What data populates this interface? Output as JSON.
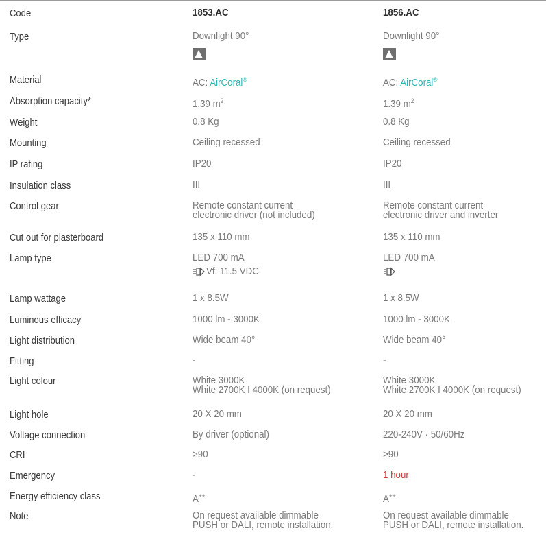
{
  "columns": {
    "label": "Code",
    "product1": "1853.AC",
    "product2": "1856.AC"
  },
  "rows": {
    "type": {
      "label": "Type",
      "v1": "Downlight 90°",
      "v2": "Downlight 90°"
    },
    "material": {
      "label": "Material",
      "prefix1": "AC: ",
      "link1": "AirCoral",
      "reg1": "®",
      "prefix2": "AC: ",
      "link2": "AirCoral",
      "reg2": "®"
    },
    "absorption": {
      "label": "Absorption capacity*",
      "v1": "1.39 m",
      "sup1": "2",
      "v2": "1.39 m",
      "sup2": "2"
    },
    "weight": {
      "label": "Weight",
      "v1": "0.8 Kg",
      "v2": "0.8 Kg"
    },
    "mounting": {
      "label": "Mounting",
      "v1": "Ceiling recessed",
      "v2": "Ceiling recessed"
    },
    "ip": {
      "label": "IP rating",
      "v1": "IP20",
      "v2": "IP20"
    },
    "insulation": {
      "label": "Insulation class",
      "v1": "III",
      "v2": "III"
    },
    "control": {
      "label": "Control gear",
      "v1a": "Remote constant current",
      "v1b": "electronic driver (not included)",
      "v2a": "Remote constant current",
      "v2b": "electronic driver and inverter"
    },
    "cutout": {
      "label": "Cut out for plasterboard",
      "v1": "135 x 110 mm",
      "v2": "135 x 110 mm"
    },
    "lamptype": {
      "label": "Lamp type",
      "v1": "LED 700 mA",
      "v1vf": "Vf: 11.5 VDC",
      "v2": "LED 700 mA"
    },
    "wattage": {
      "label": "Lamp wattage",
      "v1": "1 x 8.5W",
      "v2": "1 x 8.5W"
    },
    "efficacy": {
      "label": "Luminous efficacy",
      "v1": "1000 lm - 3000K",
      "v2": "1000 lm - 3000K"
    },
    "distribution": {
      "label": "Light distribution",
      "v1": "Wide beam 40°",
      "v2": "Wide beam 40°"
    },
    "fitting": {
      "label": "Fitting",
      "v1": "-",
      "v2": "-"
    },
    "colour": {
      "label": "Light colour",
      "v1a": "White 3000K",
      "v1b": "White 2700K I 4000K (on request)",
      "v2a": "White 3000K",
      "v2b": "White 2700K I 4000K (on request)"
    },
    "hole": {
      "label": "Light hole",
      "v1": "20 X 20 mm",
      "v2": "20 X 20 mm"
    },
    "voltage": {
      "label": "Voltage connection",
      "v1": "By driver (optional)",
      "v2": "220-240V · 50/60Hz"
    },
    "cri": {
      "label": "CRI",
      "v1": ">90",
      "v2": ">90"
    },
    "emergency": {
      "label": "Emergency",
      "v1": "-",
      "v2": "1 hour"
    },
    "energy": {
      "label": "Energy efficiency class",
      "v1": "A",
      "sup1": "++",
      "v2": "A",
      "sup2": "++"
    },
    "note": {
      "label": "Note",
      "v1a": "On request available dimmable",
      "v1b": "PUSH or DALI, remote installation.",
      "v2a": "On request available dimmable",
      "v2b": "PUSH or DALI, remote installation."
    }
  },
  "colors": {
    "accent": "#2fb5b5",
    "alert": "#d0393b",
    "label": "#3a3a3a",
    "value": "#7a7a7a"
  },
  "icons": {
    "type": "downlight-icon",
    "lamp": "led-lamp-icon"
  }
}
